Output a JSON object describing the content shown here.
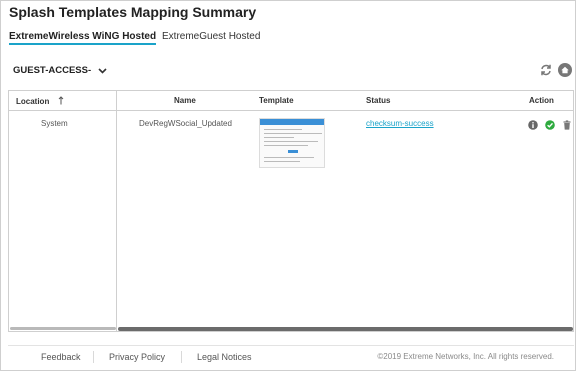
{
  "page": {
    "title": "Splash Templates Mapping Summary"
  },
  "tabs": [
    {
      "label": "ExtremeWireless WiNG Hosted",
      "active": true
    },
    {
      "label": "ExtremeGuest Hosted",
      "active": false
    }
  ],
  "selector": {
    "value": "GUEST-ACCESS-"
  },
  "table": {
    "columns": [
      "Location",
      "Name",
      "Template",
      "Status",
      "Action"
    ],
    "rows": [
      {
        "location": "System",
        "name": "DevRegWSocial_Updated",
        "status": "checksum-success"
      }
    ]
  },
  "footer": {
    "links": [
      "Feedback",
      "Privacy Policy",
      "Legal Notices"
    ],
    "copyright": "©2019 Extreme Networks, Inc. All rights reserved."
  },
  "colors": {
    "accent": "#1aa3c9",
    "success": "#2eaa3e"
  },
  "icons": [
    "refresh-icon",
    "home-icon",
    "chevron-down-icon",
    "sort-up-icon",
    "info-icon",
    "check-circle-icon",
    "trash-icon"
  ]
}
